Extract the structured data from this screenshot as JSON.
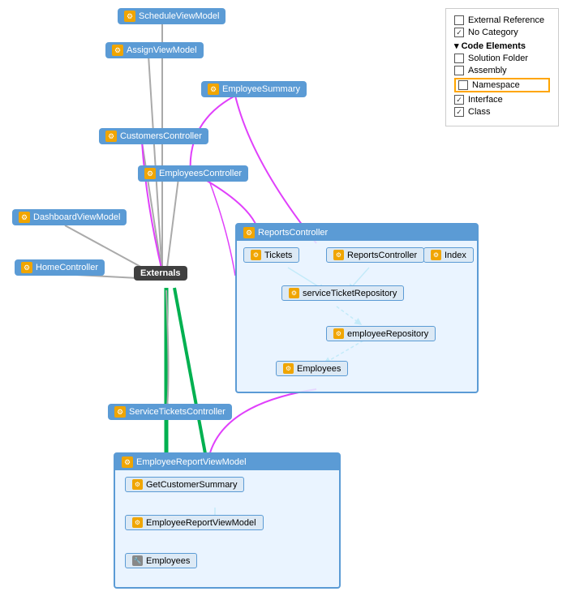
{
  "legend": {
    "items": [
      {
        "id": "external-ref",
        "label": "External Reference",
        "checked": false
      },
      {
        "id": "no-category",
        "label": "No Category",
        "checked": true
      },
      {
        "id": "code-elements-title",
        "label": "Code Elements",
        "isTitle": true
      },
      {
        "id": "solution-folder",
        "label": "Solution Folder",
        "checked": false
      },
      {
        "id": "assembly",
        "label": "Assembly",
        "checked": false
      },
      {
        "id": "namespace",
        "label": "Namespace",
        "checked": false,
        "highlighted": true
      },
      {
        "id": "interface",
        "label": "Interface",
        "checked": true
      },
      {
        "id": "class",
        "label": "Class",
        "checked": true
      }
    ]
  },
  "nodes": {
    "scheduleViewModel": "ScheduleViewModel",
    "assignViewModel": "AssignViewModel",
    "employeeSummary": "EmployeeSummary",
    "customersController": "CustomersController",
    "employeesController": "EmployeesController",
    "dashboardViewModel": "DashboardViewModel",
    "homeController": "HomeController",
    "externals": "Externals",
    "serviceTicketsController": "ServiceTicketsController",
    "reportsController": "ReportsController",
    "tickets": "Tickets",
    "reportsControllerInner": "ReportsController",
    "index": "Index",
    "serviceTicketRepository": "serviceTicketRepository",
    "employeeRepository": "employeeRepository",
    "employeesInner": "Employees",
    "employeeReportViewModel": "EmployeeReportViewModel",
    "getCustomerSummary": "GetCustomerSummary",
    "employeeReportViewModelInner": "EmployeeReportViewModel",
    "employeesBottom": "Employees"
  }
}
